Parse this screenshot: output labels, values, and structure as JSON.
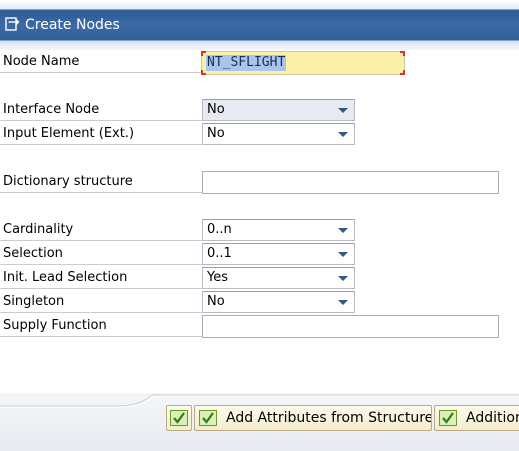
{
  "window": {
    "title": "Create Nodes",
    "title_icon": "dialog-create-icon"
  },
  "form": {
    "node_name": {
      "label": "Node Name",
      "value": "NT_SFLIGHT"
    },
    "interface_node": {
      "label": "Interface Node",
      "value": "No"
    },
    "input_element": {
      "label": "Input Element (Ext.)",
      "value": "No"
    },
    "dictionary_structure": {
      "label": "Dictionary structure",
      "value": ""
    },
    "cardinality": {
      "label": "Cardinality",
      "value": "0..n"
    },
    "selection": {
      "label": "Selection",
      "value": "0..1"
    },
    "init_lead_selection": {
      "label": "Init. Lead Selection",
      "value": "Yes"
    },
    "singleton": {
      "label": "Singleton",
      "value": "No"
    },
    "supply_function": {
      "label": "Supply Function",
      "value": ""
    }
  },
  "footer": {
    "buttons": [
      {
        "label": "",
        "icon": "check-icon"
      },
      {
        "label": "Add Attributes from Structure",
        "icon": "check-icon"
      },
      {
        "label": "Addition",
        "icon": "check-icon"
      }
    ]
  },
  "colors": {
    "title_bar": "#3b6aa5",
    "required_field": "#fbf1a6",
    "dropdown_arrow": "#39567f",
    "button_bg": "#f3eccd"
  }
}
